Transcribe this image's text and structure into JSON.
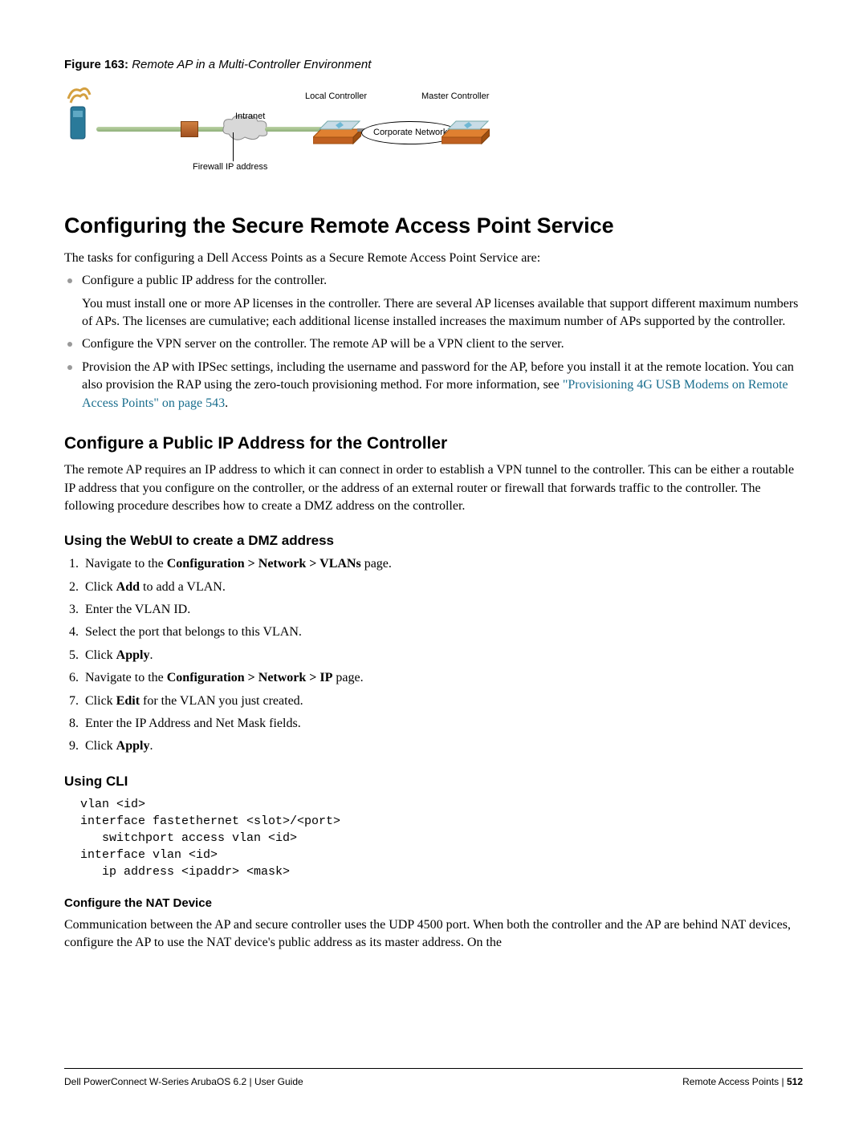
{
  "figure": {
    "label": "Figure 163:",
    "title": "Remote AP in a Multi-Controller Environment",
    "labels": {
      "local_controller": "Local Controller",
      "master_controller": "Master Controller",
      "intranet": "Intranet",
      "corporate_network": "Corporate Network",
      "firewall_ip": "Firewall IP address"
    }
  },
  "h1": "Configuring the Secure Remote Access Point Service",
  "intro": "The tasks for configuring a  Dell Access Points as a Secure Remote Access Point Service are:",
  "bullets": [
    {
      "text": "Configure a public IP address for the controller.",
      "sub": "You must install one or more AP licenses in the controller. There are several AP licenses available that support different maximum numbers of APs. The licenses are cumulative; each additional license installed increases the maximum number of APs supported by the controller."
    },
    {
      "text": "Configure the VPN server on the controller. The remote AP will be a VPN client to the server."
    },
    {
      "text_pre": "Provision the AP with IPSec settings, including the username and password for the AP, before you install it at the remote location. You can also provision the RAP using the zero-touch provisioning method. For more information, see ",
      "link": "\"Provisioning 4G USB Modems on Remote Access Points\" on page 543",
      "text_post": "."
    }
  ],
  "h2": "Configure a Public IP Address for the Controller",
  "p2": "The remote AP requires an IP address to which it can connect in order to establish a VPN tunnel to the controller. This can be either a routable IP address that you configure on the controller, or the address of an external router or firewall that forwards traffic to the controller. The following procedure describes how to create a DMZ address on the controller.",
  "h3a": "Using the WebUI to create a DMZ address",
  "steps": {
    "s1a": "Navigate to the ",
    "s1b": "Configuration > Network > VLANs",
    "s1c": " page.",
    "s2a": "Click ",
    "s2b": "Add",
    "s2c": " to add a VLAN.",
    "s3": "Enter the VLAN ID.",
    "s4": "Select the port that belongs to this VLAN.",
    "s5a": "Click ",
    "s5b": "Apply",
    "s5c": ".",
    "s6a": "Navigate to the ",
    "s6b": "Configuration > Network > IP",
    "s6c": " page.",
    "s7a": "Click ",
    "s7b": "Edit",
    "s7c": " for the VLAN you just created.",
    "s8": "Enter the IP Address and Net Mask fields.",
    "s9a": "Click ",
    "s9b": "Apply",
    "s9c": "."
  },
  "h3b": "Using CLI",
  "cli": "vlan <id>\ninterface fastethernet <slot>/<port>\n   switchport access vlan <id>\ninterface vlan <id>\n   ip address <ipaddr> <mask>",
  "h4": "Configure the NAT Device",
  "p4": "Communication between the AP and secure controller uses the UDP 4500 port. When both the controller and the AP are behind NAT devices, configure the AP to use the NAT device's public address as its master address. On the",
  "footer": {
    "left": "Dell PowerConnect W-Series ArubaOS 6.2 | User Guide",
    "right_label": "Remote Access Points",
    "right_sep": " | ",
    "right_page": "512"
  }
}
